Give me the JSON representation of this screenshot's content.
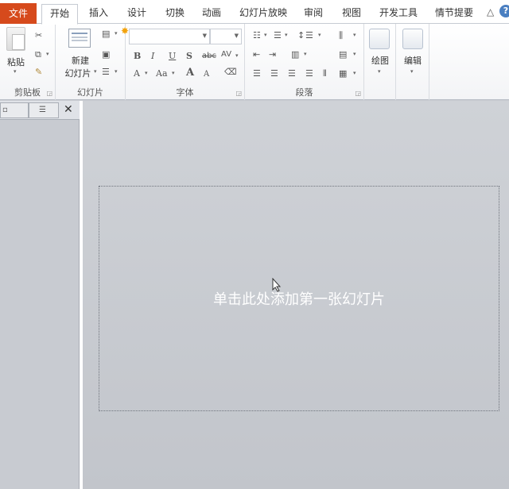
{
  "tabs": {
    "file": "文件",
    "home": "开始",
    "insert": "插入",
    "design": "设计",
    "transitions": "切换",
    "animations": "动画",
    "slideshow": "幻灯片放映",
    "review": "审阅",
    "view": "视图",
    "developer": "开发工具",
    "storyboard": "情节提要"
  },
  "ribbon": {
    "clipboard": {
      "label": "剪贴板",
      "paste": "粘贴"
    },
    "slides": {
      "label": "幻灯片",
      "new_slide_line1": "新建",
      "new_slide_line2": "幻灯片"
    },
    "font": {
      "label": "字体",
      "bold": "B",
      "italic": "I",
      "underline": "U",
      "shadow": "S",
      "strike": "abc",
      "spacing": "AV",
      "color_a": "A",
      "case": "Aa",
      "grow": "A",
      "shrink": "A"
    },
    "paragraph": {
      "label": "段落"
    },
    "drawing": {
      "label": "绘图"
    },
    "editing": {
      "label": "编辑"
    }
  },
  "slide": {
    "placeholder": "单击此处添加第一张幻灯片"
  },
  "colors": {
    "file_tab": "#d64a1c",
    "slide_bg": "#c8cbd1"
  }
}
